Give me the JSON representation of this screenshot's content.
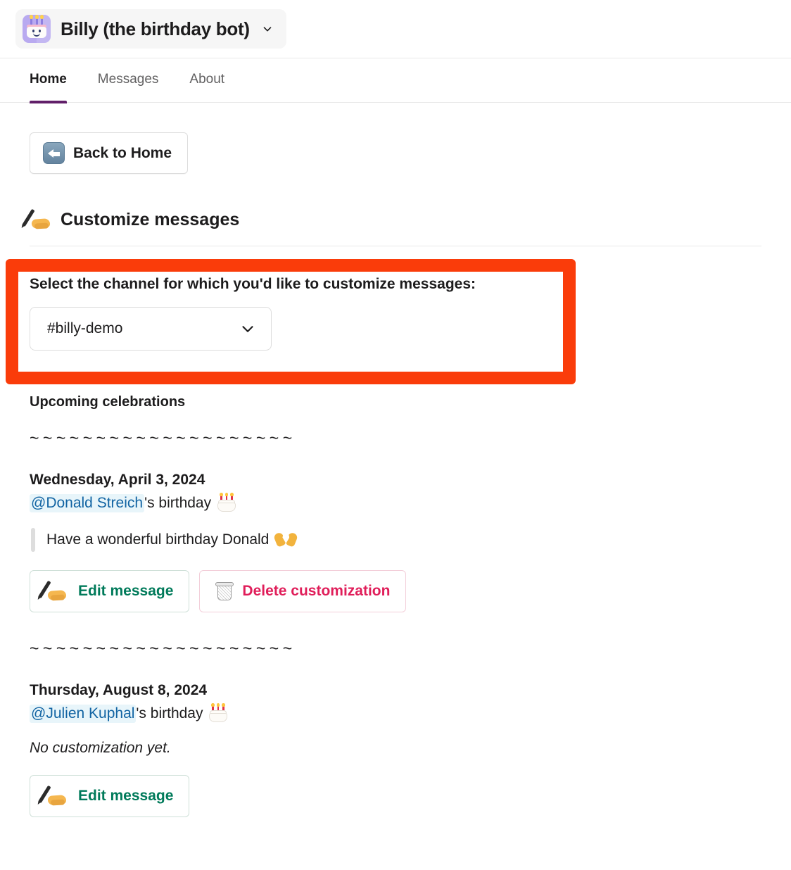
{
  "header": {
    "app_name": "Billy (the birthday bot)",
    "app_icon": "birthday-cake-app-icon",
    "caret_icon": "chevron-down-icon"
  },
  "tabs": [
    {
      "label": "Home",
      "active": true
    },
    {
      "label": "Messages",
      "active": false
    },
    {
      "label": "About",
      "active": false
    }
  ],
  "nav": {
    "back_label": "Back to Home",
    "back_icon": "left-arrow-emoji"
  },
  "section": {
    "icon": "writing-hand-emoji",
    "title": "Customize messages"
  },
  "channel_picker": {
    "highlighted": true,
    "highlight_color": "#fa3c0a",
    "label": "Select the channel for which you'd like to customize messages:",
    "selected_value": "#billy-demo",
    "chevron_icon": "chevron-down-icon"
  },
  "celebrations": {
    "heading": "Upcoming celebrations",
    "divider": "~~~~~~~~~~~~~~~~~~~~",
    "entries": [
      {
        "date": "Wednesday, April 3, 2024",
        "mention": "@Donald Streich",
        "suffix": "'s birthday",
        "cake_icon": "birthday-cake-emoji",
        "custom_message": "Have a wonderful birthday Donald",
        "message_emoji": "heart-hands-emoji",
        "no_customization_text": null,
        "buttons": [
          {
            "label": "Edit message",
            "icon": "writing-hand-emoji",
            "style": "edit"
          },
          {
            "label": "Delete customization",
            "icon": "wastebasket-emoji",
            "style": "delete"
          }
        ]
      },
      {
        "date": "Thursday, August 8, 2024",
        "mention": "@Julien Kuphal",
        "suffix": "'s birthday",
        "cake_icon": "birthday-cake-emoji",
        "custom_message": null,
        "message_emoji": null,
        "no_customization_text": "No customization yet.",
        "buttons": [
          {
            "label": "Edit message",
            "icon": "writing-hand-emoji",
            "style": "edit"
          }
        ]
      }
    ]
  },
  "colors": {
    "accent_purple": "#611f69",
    "green": "#007a5a",
    "red": "#e01e5a",
    "link_blue": "#1264a3",
    "highlight_orange": "#fa3c0a"
  }
}
